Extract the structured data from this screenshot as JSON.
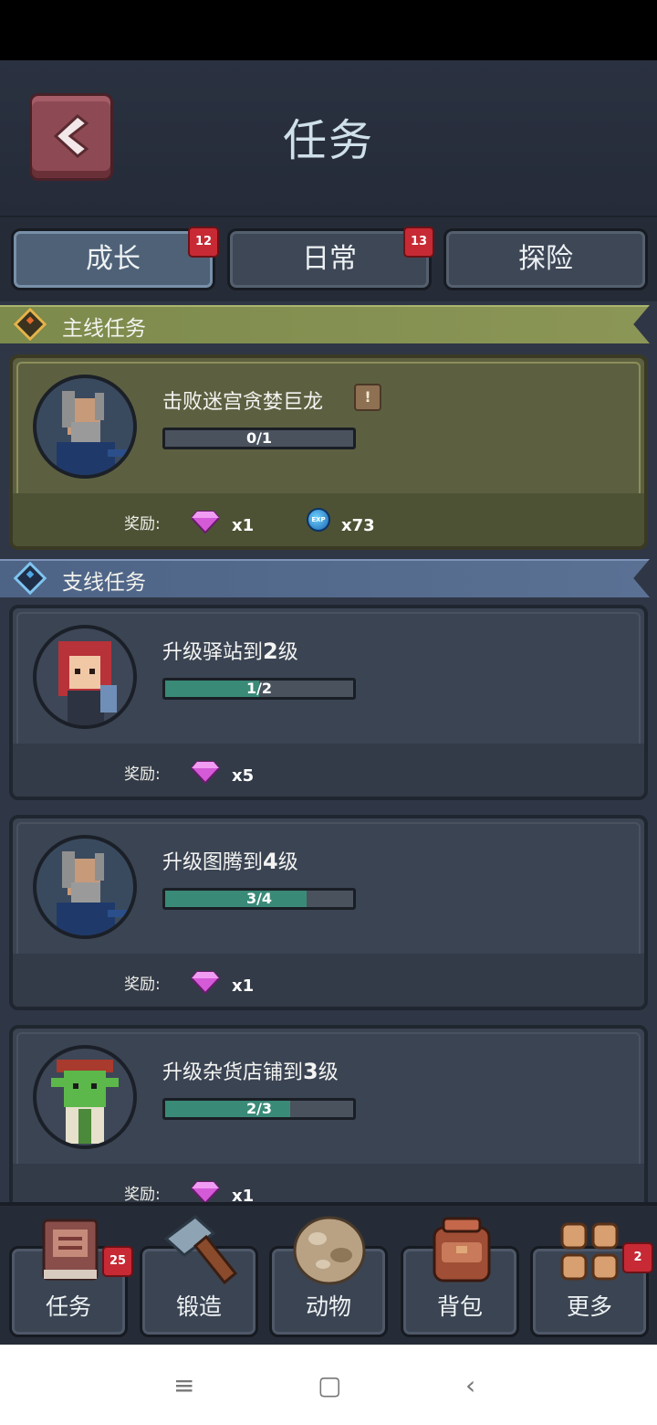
{
  "header": {
    "title": "任务"
  },
  "tabs": [
    {
      "label": "成长",
      "badge": "12",
      "active": true
    },
    {
      "label": "日常",
      "badge": "13",
      "active": false
    },
    {
      "label": "探险",
      "badge": "",
      "active": false
    }
  ],
  "main_section": {
    "label": "主线任务"
  },
  "side_section": {
    "label": "支线任务"
  },
  "quests": [
    {
      "name": "击败迷宫贪婪巨龙",
      "progress": "0/1",
      "progress_fraction": 0.0,
      "reward_label": "奖励:",
      "reward_gem": "x1",
      "reward_exp": "x73",
      "exp_icon_text": "EXP"
    },
    {
      "name_pre": "升级驿站到",
      "name_num": "2",
      "name_post": "级",
      "progress": "1/2",
      "progress_fraction": 0.5,
      "reward_label": "奖励:",
      "reward_gem": "x5"
    },
    {
      "name_pre": "升级图腾到",
      "name_num": "4",
      "name_post": "级",
      "progress": "3/4",
      "progress_fraction": 0.75,
      "reward_label": "奖励:",
      "reward_gem": "x1"
    },
    {
      "name_pre": "升级杂货店铺到",
      "name_num": "3",
      "name_post": "级",
      "progress": "2/3",
      "progress_fraction": 0.6667,
      "reward_label": "奖励:",
      "reward_gem": "x1"
    }
  ],
  "bottom_nav": [
    {
      "label": "任务",
      "badge": "25",
      "icon": "quest-book-icon"
    },
    {
      "label": "锻造",
      "badge": "",
      "icon": "hammer-icon"
    },
    {
      "label": "动物",
      "badge": "",
      "icon": "egg-icon"
    },
    {
      "label": "背包",
      "badge": "",
      "icon": "backpack-icon"
    },
    {
      "label": "更多",
      "badge": "2",
      "icon": "grid-more-icon"
    }
  ],
  "system_nav": {
    "menu": "≡",
    "home": "▢",
    "back": "‹"
  },
  "colors": {
    "main_section": "#7c8a4c",
    "side_section": "#4e6486",
    "progress_fill": "#3a8a78",
    "badge": "#c72a34",
    "back_button": "#8e4a54"
  }
}
